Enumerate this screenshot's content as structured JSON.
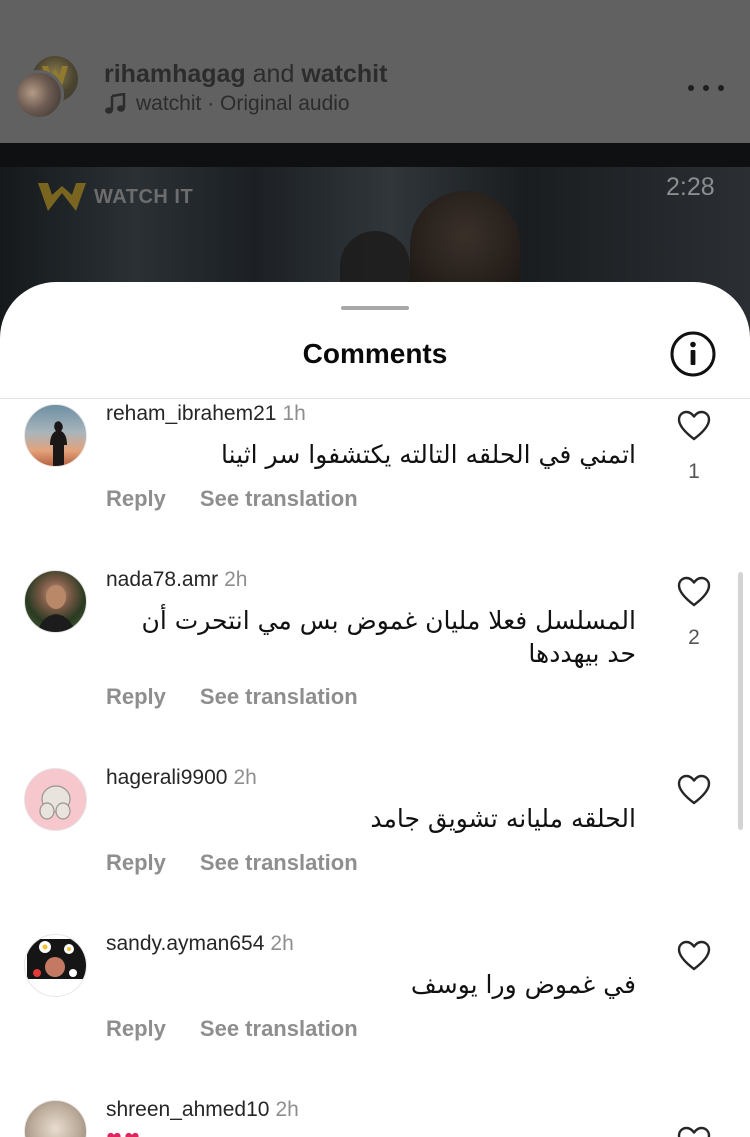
{
  "post": {
    "author1": "rihamhagag",
    "connector": "and",
    "author2": "watchit",
    "audio_icon": "music-note-icon",
    "audio": "watchit · Original audio",
    "more_icon": "more-horizontal-icon",
    "video_logo": "WATCH IT",
    "video_time": "2:28"
  },
  "sheet": {
    "title": "Comments",
    "info_icon": "info-circle-icon"
  },
  "comments": [
    {
      "username": "reham_ibrahem21",
      "time": "1h",
      "text": "اتمني في الحلقه التالته يكتشفوا سر اثينا",
      "reply": "Reply",
      "translate": "See translation",
      "likes": "1"
    },
    {
      "username": "nada78.amr",
      "time": "2h",
      "text": "المسلسل فعلا مليان غموض بس مي انتحرت أن حد بيهددها",
      "reply": "Reply",
      "translate": "See translation",
      "likes": "2"
    },
    {
      "username": "hagerali9900",
      "time": "2h",
      "text": "الحلقه مليانه تشويق جامد",
      "reply": "Reply",
      "translate": "See translation",
      "likes": ""
    },
    {
      "username": "sandy.ayman654",
      "time": "2h",
      "text": "في غموض ورا يوسف",
      "reply": "Reply",
      "translate": "See translation",
      "likes": ""
    },
    {
      "username": "shreen_ahmed10",
      "time": "2h",
      "text": "",
      "reply": "",
      "translate": "",
      "likes": ""
    }
  ],
  "colors": {
    "secondary_text": "#8e8e8e",
    "overlay": "#616161",
    "heart_outline": "#262626"
  }
}
